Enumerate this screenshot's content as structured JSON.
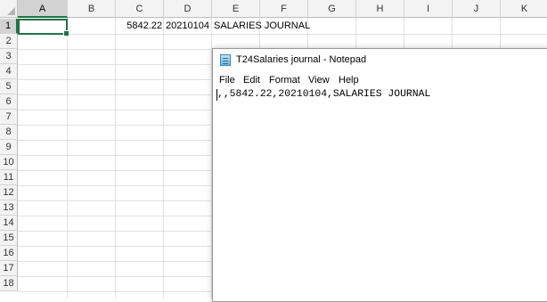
{
  "spreadsheet": {
    "columns": [
      "A",
      "B",
      "C",
      "D",
      "E",
      "F",
      "G",
      "H",
      "I",
      "J",
      "K"
    ],
    "rows": [
      "1",
      "2",
      "3",
      "4",
      "5",
      "6",
      "7",
      "8",
      "9",
      "10",
      "11",
      "12",
      "13",
      "14",
      "15",
      "16",
      "17",
      "18"
    ],
    "active_cell": "A1",
    "cells": {
      "C1": "5842.22",
      "D1": "20210104",
      "E1": "SALARIES JOURNAL"
    }
  },
  "notepad": {
    "title": "T24Salaries journal - Notepad",
    "menu": [
      "File",
      "Edit",
      "Format",
      "View",
      "Help"
    ],
    "content": ",,5842.22,20210104,SALARIES JOURNAL"
  },
  "colors": {
    "accent_green": "#217346",
    "header_bg": "#f3f3f3",
    "gridline": "#e1e1e1"
  }
}
